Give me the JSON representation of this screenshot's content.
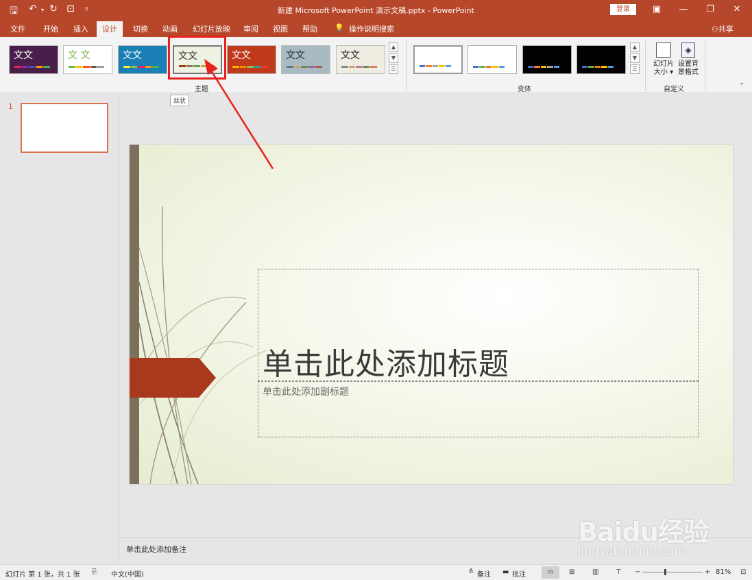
{
  "window": {
    "title": "新建 Microsoft PowerPoint 演示文稿.pptx  -  PowerPoint",
    "login": "登录"
  },
  "tabs": [
    "文件",
    "开始",
    "插入",
    "设计",
    "切换",
    "动画",
    "幻灯片放映",
    "审阅",
    "视图",
    "帮助",
    "操作说明搜索"
  ],
  "share": "共享",
  "ribbon": {
    "themes": [
      {
        "label": "文文",
        "bg": "#4a1e4a",
        "fg": "#ffffff"
      },
      {
        "label": "文 文",
        "bg": "#ffffff",
        "fg": "#7cb342"
      },
      {
        "label": "文文",
        "bg": "#1a7fb5",
        "fg": "#ffffff"
      },
      {
        "label": "文文",
        "bg": "#eef2e2",
        "fg": "#333333"
      },
      {
        "label": "文文",
        "bg": "#c0391b",
        "fg": "#ffffff"
      },
      {
        "label": "文文",
        "bg": "#a9bac2",
        "fg": "#1f2f38"
      },
      {
        "label": "文文",
        "bg": "#efece2",
        "fg": "#222222"
      }
    ],
    "group_themes": "主题",
    "group_variants": "变体",
    "group_customize": "自定义",
    "slide_size_label_1": "幻灯片",
    "slide_size_label_2": "大小 ▾",
    "format_bg_label_1": "设置背",
    "format_bg_label_2": "景格式"
  },
  "tooltip": "丝状",
  "thumbs": {
    "number": "1"
  },
  "slide": {
    "title_placeholder": "单击此处添加标题",
    "subtitle_placeholder": "单击此处添加副标题"
  },
  "notes_placeholder": "单击此处添加备注",
  "status": {
    "slide_info": "幻灯片 第 1 张，共 1 张",
    "language": "中文(中国)",
    "notes_btn": "备注",
    "comments_btn": "批注",
    "zoom": "81%",
    "zoom_level": 0.81
  },
  "watermark": {
    "logo": "Baidu经验",
    "url": "jingyan.baidu.com"
  }
}
